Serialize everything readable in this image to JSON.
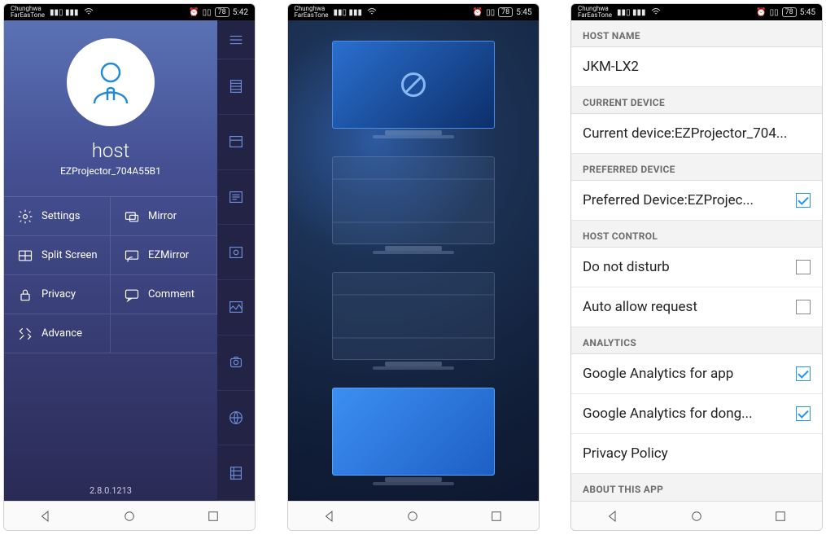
{
  "statusbar": {
    "carrier": "Chunghwa\nFarEasTone",
    "battery": "78",
    "time1": "5:42",
    "time2": "5:45",
    "time3": "5:45"
  },
  "screen1": {
    "host_label": "host",
    "projector": "EZProjector_704A55B1",
    "menu": {
      "settings": "Settings",
      "mirror": "Mirror",
      "split": "Split Screen",
      "ezmirror": "EZMirror",
      "privacy": "Privacy",
      "comment": "Comment",
      "advance": "Advance"
    },
    "version": "2.8.0.1213"
  },
  "screen3": {
    "sections": {
      "hostname": "HOST NAME",
      "current": "CURRENT DEVICE",
      "preferred": "PREFERRED DEVICE",
      "hostctrl": "HOST CONTROL",
      "analytics": "ANALYTICS",
      "about": "ABOUT THIS APP"
    },
    "hostname_value": "JKM-LX2",
    "current_device": "Current device:EZProjector_704...",
    "preferred_device": "Preferred Device:EZProjec...",
    "dnd": "Do not disturb",
    "auto_allow": "Auto allow request",
    "ga_app": "Google Analytics for app",
    "ga_dongle": "Google Analytics for dong...",
    "privacy_policy": "Privacy Policy"
  }
}
